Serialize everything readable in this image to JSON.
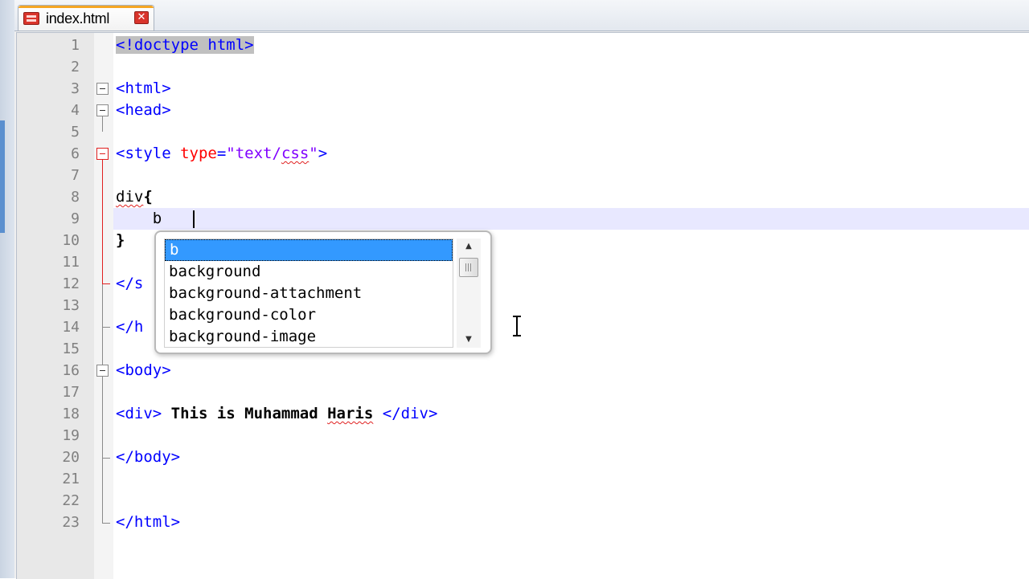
{
  "tab": {
    "file_name": "index.html",
    "close_glyph": "✕",
    "file_icon": "html-file-icon",
    "accent_color": "#f5a623"
  },
  "editor": {
    "lines": [
      {
        "n": "1",
        "parts": [
          {
            "t": "<!doctype html>",
            "c": "tag sel"
          }
        ]
      },
      {
        "n": "2",
        "parts": []
      },
      {
        "n": "3",
        "parts": [
          {
            "t": "<html>",
            "c": "tag"
          }
        ]
      },
      {
        "n": "4",
        "parts": [
          {
            "t": "<head>",
            "c": "tag"
          }
        ]
      },
      {
        "n": "5",
        "parts": []
      },
      {
        "n": "6",
        "parts": [
          {
            "t": "<style ",
            "c": "tag"
          },
          {
            "t": "type",
            "c": "attr"
          },
          {
            "t": "=",
            "c": "tag"
          },
          {
            "t": "\"text/",
            "c": "val"
          },
          {
            "t": "css",
            "c": "val squig"
          },
          {
            "t": "\"",
            "c": "val"
          },
          {
            "t": ">",
            "c": "tag"
          }
        ]
      },
      {
        "n": "7",
        "parts": []
      },
      {
        "n": "8",
        "parts": [
          {
            "t": "div",
            "c": "squig"
          },
          {
            "t": "{",
            "c": "bold"
          }
        ]
      },
      {
        "n": "9",
        "parts": [
          {
            "t": "    b",
            "c": ""
          }
        ]
      },
      {
        "n": "10",
        "parts": [
          {
            "t": "}",
            "c": "bold"
          }
        ]
      },
      {
        "n": "11",
        "parts": []
      },
      {
        "n": "12",
        "parts": [
          {
            "t": "</s",
            "c": "tag"
          }
        ]
      },
      {
        "n": "13",
        "parts": []
      },
      {
        "n": "14",
        "parts": [
          {
            "t": "</h",
            "c": "tag"
          }
        ]
      },
      {
        "n": "15",
        "parts": []
      },
      {
        "n": "16",
        "parts": [
          {
            "t": "<body>",
            "c": "tag"
          }
        ]
      },
      {
        "n": "17",
        "parts": []
      },
      {
        "n": "18",
        "parts": [
          {
            "t": "<div>",
            "c": "tag"
          },
          {
            "t": " This is Muhammad ",
            "c": "bold"
          },
          {
            "t": "Haris",
            "c": "bold squig"
          },
          {
            "t": " ",
            "c": ""
          },
          {
            "t": "</div>",
            "c": "tag"
          }
        ]
      },
      {
        "n": "19",
        "parts": []
      },
      {
        "n": "20",
        "parts": [
          {
            "t": "</body>",
            "c": "tag"
          }
        ]
      },
      {
        "n": "21",
        "parts": []
      },
      {
        "n": "22",
        "parts": []
      },
      {
        "n": "23",
        "parts": [
          {
            "t": "</html>",
            "c": "tag"
          }
        ]
      }
    ],
    "colors": {
      "tag": "#0000ff",
      "attribute": "#ff0000",
      "value": "#8000ff",
      "current_line": "#e8e8ff",
      "fold_active": "#e02020"
    }
  },
  "autocomplete": {
    "items": [
      "b",
      "background",
      "background-attachment",
      "background-color",
      "background-image"
    ],
    "selected_index": 0,
    "scroll_up_glyph": "▲",
    "scroll_down_glyph": "▼"
  }
}
